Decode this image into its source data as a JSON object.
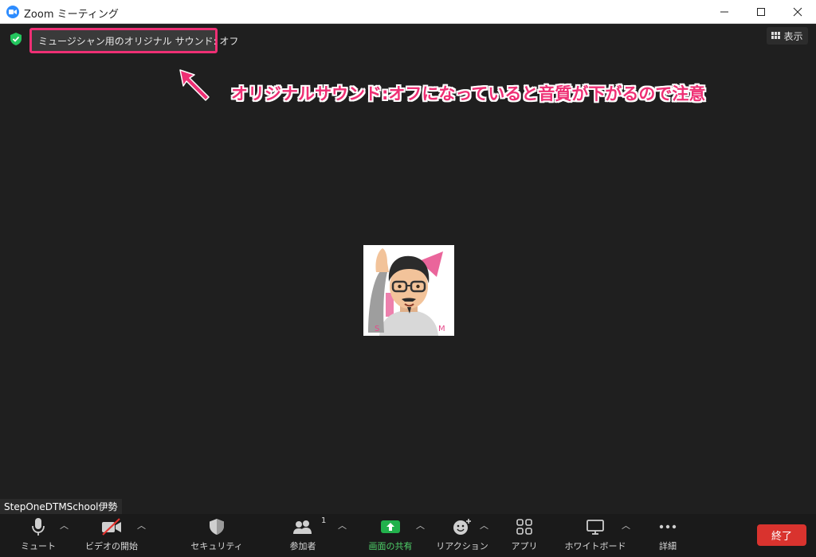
{
  "window": {
    "title": "Zoom ミーティング",
    "icon": "zoom-logo-icon",
    "controls": [
      "minimize-icon",
      "maximize-icon",
      "close-icon"
    ]
  },
  "meeting": {
    "audio_status": "ミュージシャン用のオリジナル サウンド: オフ",
    "view_label": "表示",
    "annotation": "オリジナルサウンド:オフになっていると音質が下がるので注意",
    "participant_name": "StepOneDTMSchool伊勢"
  },
  "toolbar": {
    "mute": {
      "label": "ミュート",
      "icon": "microphone-icon"
    },
    "video": {
      "label": "ビデオの開始",
      "icon": "video-off-icon"
    },
    "security": {
      "label": "セキュリティ",
      "icon": "shield-icon"
    },
    "participants": {
      "label": "参加者",
      "count": "1",
      "icon": "participants-icon"
    },
    "share": {
      "label": "画面の共有",
      "icon": "share-screen-icon"
    },
    "reactions": {
      "label": "リアクション",
      "icon": "emoji-add-icon"
    },
    "apps": {
      "label": "アプリ",
      "icon": "apps-icon"
    },
    "whiteboard": {
      "label": "ホワイトボード",
      "icon": "whiteboard-icon"
    },
    "more": {
      "label": "詳細",
      "icon": "more-icon"
    },
    "end": {
      "label": "終了"
    }
  },
  "colors": {
    "annotation": "#ee2f74",
    "share_green": "#22b14c",
    "end_red": "#d9332e",
    "shield_green": "#23c55e"
  }
}
